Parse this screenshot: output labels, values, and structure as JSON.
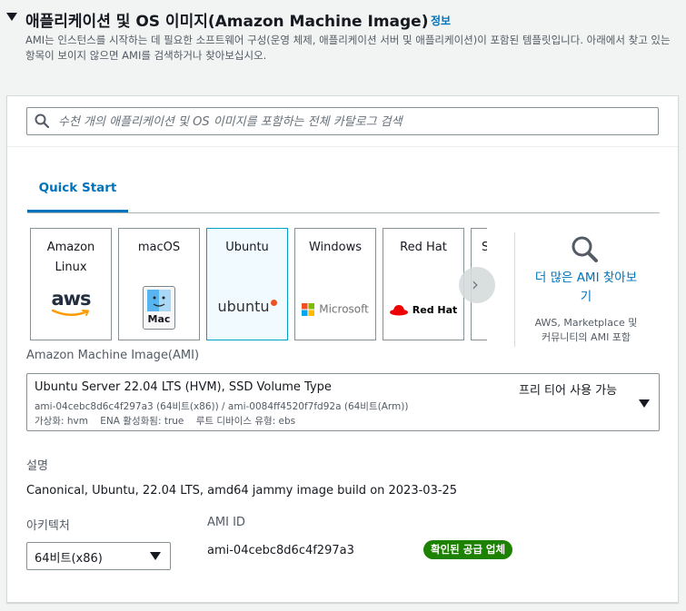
{
  "section": {
    "title": "애플리케이션 및 OS 이미지(Amazon Machine Image)",
    "info_link": "정보",
    "description": "AMI는 인스턴스를 시작하는 데 필요한 소프트웨어 구성(운영 체제, 애플리케이션 서버 및 애플리케이션)이 포함된 템플릿입니다. 아래에서 찾고 있는 항목이 보이지 않으면 AMI를 검색하거나 찾아보십시오."
  },
  "search": {
    "placeholder": "수천 개의 애플리케이션 및 OS 이미지를 포함하는 전체 카탈로그 검색"
  },
  "tabs": [
    {
      "label": "Quick Start"
    }
  ],
  "tiles": [
    {
      "name": "Amazon Linux",
      "line1": "Amazon",
      "line2": "Linux",
      "logo_text": "aws"
    },
    {
      "name": "macOS",
      "line1": "macOS",
      "logo_text": "Mac"
    },
    {
      "name": "Ubuntu",
      "line1": "Ubuntu",
      "logo_text": "ubuntu",
      "selected": true
    },
    {
      "name": "Windows",
      "line1": "Windows",
      "logo_text": "Microsoft"
    },
    {
      "name": "Red Hat",
      "line1": "Red Hat",
      "logo_text": "Red Hat"
    },
    {
      "name": "S",
      "line1": "S"
    }
  ],
  "more_ami": {
    "link": "더 많은 AMI 찾아보기",
    "link_line1": "더 많은 AMI 찾아보",
    "link_line2": "기",
    "sub_line1": "AWS, Marketplace 및",
    "sub_line2": "커뮤니티의 AMI 포함"
  },
  "ami": {
    "label": "Amazon Machine Image(AMI)",
    "name": "Ubuntu Server 22.04 LTS (HVM), SSD Volume Type",
    "free_tier": "프리 티어 사용 가능",
    "ids": "ami-04cebc8d6c4f297a3 (64비트(x86)) / ami-0084ff4520f7fd92a (64비트(Arm))",
    "meta": "가상화: hvm    ENA 활성화됨: true    루트 디바이스 유형: ebs"
  },
  "description": {
    "label": "설명",
    "value": "Canonical, Ubuntu, 22.04 LTS, amd64 jammy image build on 2023-03-25"
  },
  "architecture": {
    "label": "아키텍처",
    "value": "64비트(x86)"
  },
  "ami_id": {
    "label": "AMI ID",
    "value": "ami-04cebc8d6c4f297a3",
    "badge": "확인된 공급 업체"
  },
  "colors": {
    "link": "#0073bb",
    "selected_border": "#00a1c9",
    "badge": "#1d8102"
  }
}
